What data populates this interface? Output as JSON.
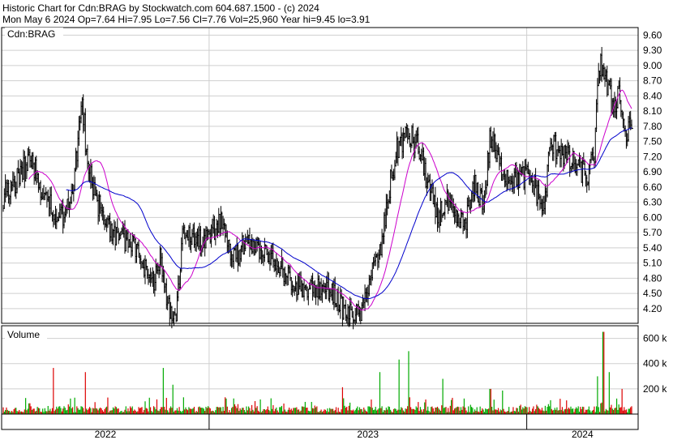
{
  "header": {
    "line1": "Historic Chart for Cdn:BRAG by Stockwatch.com 604.687.1500 - (c) 2024",
    "line2": "Mon May  6 2024  Op=7.64  Hi=7.95  Lo=7.56  Cl=7.76  Vol=25,960  Year hi=9.45  lo=3.91"
  },
  "chart_data": [
    {
      "type": "candlestick",
      "label": "Cdn:BRAG",
      "ylim": [
        3.91,
        9.75
      ],
      "y_ticks": [
        "9.60",
        "9.30",
        "9.00",
        "8.70",
        "8.40",
        "8.10",
        "7.80",
        "7.50",
        "7.20",
        "6.90",
        "6.60",
        "6.30",
        "6.00",
        "5.70",
        "5.40",
        "5.10",
        "4.80",
        "4.50",
        "4.20"
      ],
      "x_labels": [
        "2022",
        "2023",
        "2024"
      ],
      "x_year_start_fraction": [
        0.0,
        0.326,
        0.825
      ],
      "price_anchors": [
        [
          0.0,
          6.4
        ],
        [
          0.03,
          6.9
        ],
        [
          0.045,
          7.2
        ],
        [
          0.06,
          6.6
        ],
        [
          0.085,
          6.1
        ],
        [
          0.1,
          6.0
        ],
        [
          0.115,
          7.0
        ],
        [
          0.125,
          8.3
        ],
        [
          0.135,
          7.0
        ],
        [
          0.15,
          6.3
        ],
        [
          0.175,
          5.7
        ],
        [
          0.2,
          5.5
        ],
        [
          0.22,
          5.2
        ],
        [
          0.235,
          4.6
        ],
        [
          0.25,
          5.2
        ],
        [
          0.26,
          4.3
        ],
        [
          0.275,
          4.0
        ],
        [
          0.285,
          5.6
        ],
        [
          0.3,
          5.7
        ],
        [
          0.325,
          5.5
        ],
        [
          0.345,
          6.0
        ],
        [
          0.36,
          5.3
        ],
        [
          0.37,
          5.2
        ],
        [
          0.385,
          5.5
        ],
        [
          0.4,
          5.5
        ],
        [
          0.43,
          5.2
        ],
        [
          0.46,
          4.7
        ],
        [
          0.49,
          4.6
        ],
        [
          0.52,
          4.6
        ],
        [
          0.545,
          4.1
        ],
        [
          0.57,
          4.1
        ],
        [
          0.585,
          4.9
        ],
        [
          0.6,
          5.3
        ],
        [
          0.615,
          6.6
        ],
        [
          0.63,
          7.5
        ],
        [
          0.645,
          7.6
        ],
        [
          0.66,
          7.4
        ],
        [
          0.675,
          6.7
        ],
        [
          0.69,
          6.0
        ],
        [
          0.705,
          6.3
        ],
        [
          0.72,
          5.9
        ],
        [
          0.735,
          5.9
        ],
        [
          0.75,
          6.6
        ],
        [
          0.765,
          6.3
        ],
        [
          0.775,
          7.6
        ],
        [
          0.79,
          7.0
        ],
        [
          0.805,
          6.8
        ],
        [
          0.82,
          6.8
        ],
        [
          0.835,
          6.8
        ],
        [
          0.85,
          6.5
        ],
        [
          0.86,
          6.1
        ],
        [
          0.87,
          7.4
        ],
        [
          0.885,
          7.4
        ],
        [
          0.9,
          7.1
        ],
        [
          0.915,
          7.0
        ],
        [
          0.93,
          6.8
        ],
        [
          0.94,
          7.2
        ],
        [
          0.95,
          9.2
        ],
        [
          0.96,
          8.6
        ],
        [
          0.97,
          8.2
        ],
        [
          0.98,
          8.5
        ],
        [
          0.99,
          7.6
        ],
        [
          1.0,
          7.76
        ]
      ],
      "series": [
        {
          "name": "",
          "color": "#cc00cc"
        },
        {
          "name": "",
          "color": "#0000cc"
        }
      ]
    },
    {
      "type": "bar",
      "label": "Volume",
      "ylim": [
        0,
        700000
      ],
      "y_ticks": [
        "600 k",
        "400 k",
        "200 k"
      ],
      "colors": {
        "up": "#00aa00",
        "down": "#dd0000"
      },
      "spikes": [
        [
          0.08,
          0.55
        ],
        [
          0.13,
          0.5
        ],
        [
          0.255,
          0.55
        ],
        [
          0.27,
          0.35
        ],
        [
          0.54,
          0.32
        ],
        [
          0.6,
          0.5
        ],
        [
          0.63,
          0.65
        ],
        [
          0.645,
          0.75
        ],
        [
          0.7,
          0.42
        ],
        [
          0.775,
          0.3
        ],
        [
          0.795,
          0.28
        ],
        [
          0.945,
          0.45
        ],
        [
          0.955,
          0.98
        ],
        [
          0.965,
          0.5
        ],
        [
          0.985,
          0.3
        ]
      ]
    }
  ]
}
